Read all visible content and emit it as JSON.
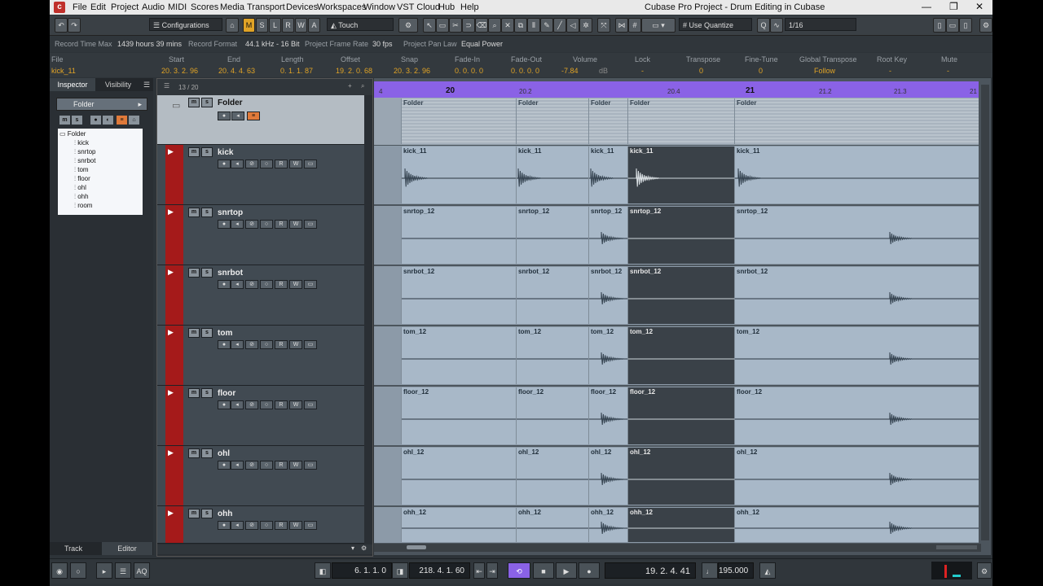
{
  "menubar": {
    "items": [
      "File",
      "Edit",
      "Project",
      "Audio",
      "MIDI",
      "Scores",
      "Media",
      "Transport",
      "Devices",
      "Workspaces",
      "Window",
      "VST Cloud",
      "Hub",
      "Help"
    ],
    "window_title": "Cubase Pro Project - Drum Editing in Cubase"
  },
  "toolbar": {
    "configurations_label": "Configurations",
    "mode_buttons": [
      "M",
      "S",
      "L",
      "R",
      "W",
      "A"
    ],
    "automation_mode": "Touch",
    "quantize_mode": "Use Quantize",
    "quantize_value": "1/16"
  },
  "statusline": {
    "record_time_max_label": "Record Time Max",
    "record_time_max_value": "1439 hours 39 mins",
    "record_format_label": "Record Format",
    "record_format_value": "44.1 kHz - 16 Bit",
    "frame_rate_label": "Project Frame Rate",
    "frame_rate_value": "30 fps",
    "pan_law_label": "Project Pan Law",
    "pan_law_value": "Equal Power"
  },
  "infoline": {
    "labels": [
      "File",
      "Start",
      "End",
      "Length",
      "Offset",
      "Snap",
      "Fade-In",
      "Fade-Out",
      "Volume",
      "Lock",
      "Transpose",
      "Fine-Tune",
      "Global Transpose",
      "Root Key",
      "Mute"
    ],
    "values": [
      "kick_11",
      "20. 3. 2. 96",
      "20. 4. 4. 63",
      "0. 1. 1. 87",
      "19. 2. 0. 68",
      "20. 3. 2. 96",
      "0. 0. 0. 0",
      "0. 0. 0. 0",
      "-7.84",
      "dB",
      "-",
      "0",
      "0",
      "Follow",
      "-",
      "-"
    ]
  },
  "inspector": {
    "tabs": [
      "Inspector",
      "Visibility"
    ],
    "folder_label": "Folder",
    "tree_root": "Folder",
    "tree_items": [
      "kick",
      "snrtop",
      "snrbot",
      "tom",
      "floor",
      "ohl",
      "ohh",
      "room"
    ],
    "bottom_tabs": [
      "Track",
      "Editor"
    ]
  },
  "tracklist": {
    "count": "13 / 20",
    "tracks": [
      {
        "name": "Folder",
        "type": "folder"
      },
      {
        "name": "kick",
        "type": "audio"
      },
      {
        "name": "snrtop",
        "type": "audio"
      },
      {
        "name": "snrbot",
        "type": "audio"
      },
      {
        "name": "tom",
        "type": "audio"
      },
      {
        "name": "floor",
        "type": "audio"
      },
      {
        "name": "ohl",
        "type": "audio"
      },
      {
        "name": "ohh",
        "type": "audio"
      }
    ]
  },
  "ruler": {
    "labels": [
      "4",
      "20",
      "20.2",
      "20.4",
      "21",
      "21.2",
      "21.3",
      "21"
    ]
  },
  "events": {
    "Folder": [
      "Folder",
      "Folder",
      "Folder",
      "Folder",
      "Folder"
    ],
    "kick": [
      "kick_11",
      "kick_11",
      "kick_11",
      "kick_11",
      "kick_11"
    ],
    "snrtop": [
      "snrtop_12",
      "snrtop_12",
      "snrtop_12",
      "snrtop_12",
      "snrtop_12"
    ],
    "snrbot": [
      "snrbot_12",
      "snrbot_12",
      "snrbot_12",
      "snrbot_12",
      "snrbot_12"
    ],
    "tom": [
      "tom_12",
      "tom_12",
      "tom_12",
      "tom_12",
      "tom_12"
    ],
    "floor": [
      "floor_12",
      "floor_12",
      "floor_12",
      "floor_12",
      "floor_12"
    ],
    "ohl": [
      "ohl_12",
      "ohl_12",
      "ohl_12",
      "ohl_12",
      "ohl_12"
    ],
    "ohh": [
      "ohh_12",
      "ohh_12",
      "ohh_12",
      "ohh_12",
      "ohh_12"
    ]
  },
  "transport": {
    "left_locator": "6. 1. 1. 0",
    "right_locator": "218. 4. 1. 60",
    "position": "19. 2. 4. 41",
    "tempo": "195.000"
  },
  "colors": {
    "track_color": "#a51a1a",
    "ruler": "#8a62e6",
    "info_values": "#e0a326"
  }
}
